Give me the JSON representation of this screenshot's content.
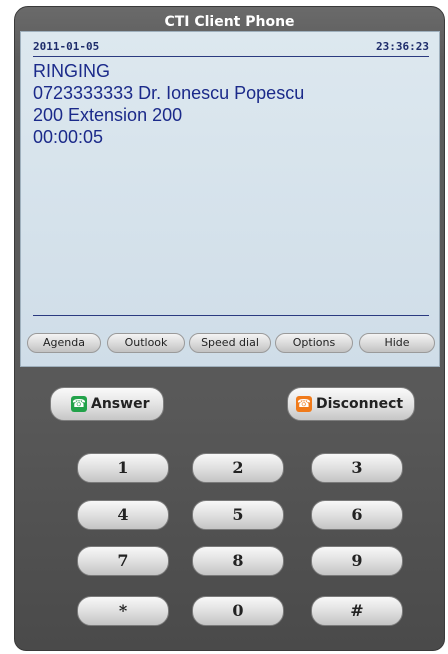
{
  "window": {
    "title": "CTI Client Phone"
  },
  "screen": {
    "date": "2011-01-05",
    "time": "23:36:23",
    "lines": [
      "RINGING",
      "0723333333 Dr. Ionescu Popescu",
      "200 Extension 200",
      "00:00:05"
    ]
  },
  "menu": [
    {
      "label": "Agenda"
    },
    {
      "label": "Outlook"
    },
    {
      "label": "Speed dial"
    },
    {
      "label": "Options"
    },
    {
      "label": "Hide"
    }
  ],
  "actions": {
    "answer": {
      "label": "Answer",
      "icon": "phone-answer-icon",
      "color": "#22a24a"
    },
    "disconnect": {
      "label": "Disconnect",
      "icon": "phone-hangup-icon",
      "color": "#f07a1a"
    }
  },
  "keypad": [
    [
      "1",
      "2",
      "3"
    ],
    [
      "4",
      "5",
      "6"
    ],
    [
      "7",
      "8",
      "9"
    ],
    [
      "*",
      "0",
      "#"
    ]
  ]
}
